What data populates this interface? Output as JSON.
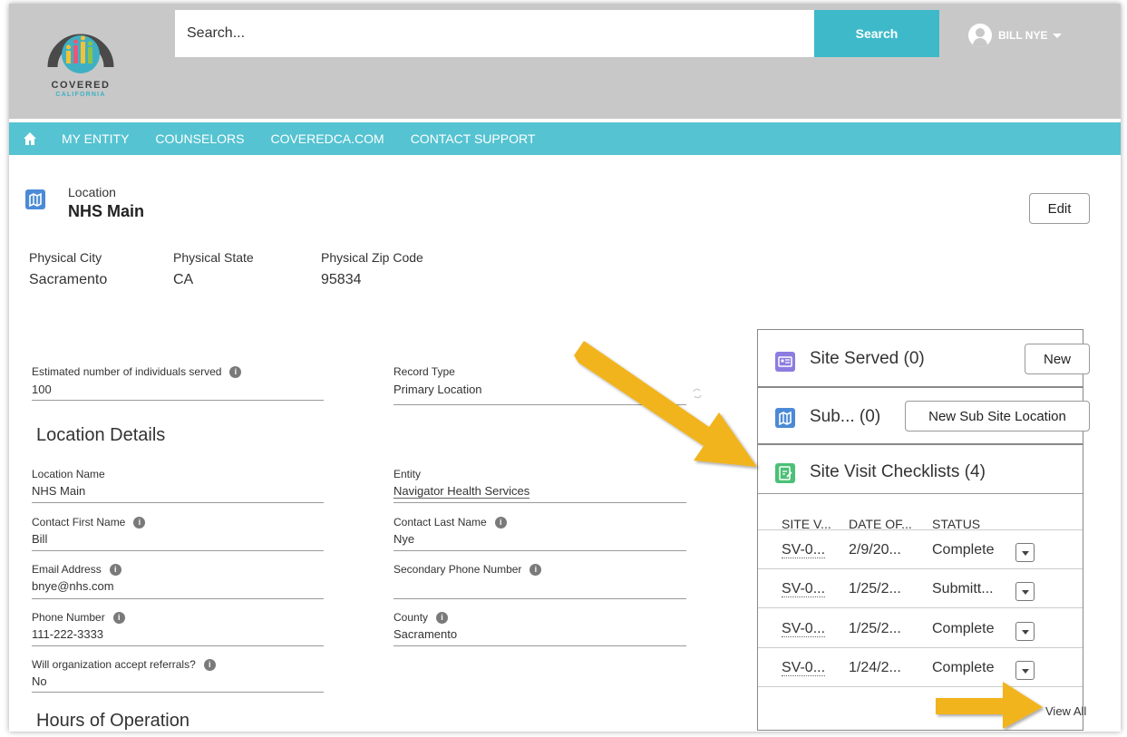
{
  "header": {
    "logo_line1": "COVERED",
    "logo_line2": "CALIFORNIA",
    "search_placeholder": "Search...",
    "search_button": "Search",
    "user_name": "BILL NYE"
  },
  "nav": {
    "items": [
      "MY ENTITY",
      "COUNSELORS",
      "COVEREDCA.COM",
      "CONTACT SUPPORT"
    ]
  },
  "record": {
    "type": "Location",
    "name": "NHS Main",
    "edit_label": "Edit",
    "highlights": [
      {
        "label": "Physical City",
        "value": "Sacramento"
      },
      {
        "label": "Physical State",
        "value": "CA"
      },
      {
        "label": "Physical Zip Code",
        "value": "95834"
      }
    ]
  },
  "fields": {
    "estimated_label": "Estimated number of individuals served",
    "estimated_value": "100",
    "record_type_label": "Record Type",
    "record_type_value": "Primary Location",
    "section_location": "Location Details",
    "location_name_label": "Location Name",
    "location_name_value": "NHS Main",
    "entity_label": "Entity",
    "entity_value": "Navigator Health Services",
    "contact_first_label": "Contact First Name",
    "contact_first_value": "Bill",
    "contact_last_label": "Contact Last Name",
    "contact_last_value": "Nye",
    "email_label": "Email Address",
    "email_value": "bnye@nhs.com",
    "secondary_phone_label": "Secondary Phone Number",
    "secondary_phone_value": "",
    "phone_label": "Phone Number",
    "phone_value": "111-222-3333",
    "county_label": "County",
    "county_value": "Sacramento",
    "referrals_label": "Will organization accept referrals?",
    "referrals_value": "No",
    "section_hours": "Hours of Operation"
  },
  "related": {
    "site_served_title": "Site Served (0)",
    "site_served_button": "New",
    "sub_site_title": "Sub... (0)",
    "sub_site_button": "New Sub Site Location",
    "checklists_title": "Site Visit Checklists (4)",
    "columns": [
      "SITE V...",
      "DATE OF...",
      "STATUS"
    ],
    "rows": [
      {
        "id": "SV-0...",
        "date": "2/9/20...",
        "status": "Complete"
      },
      {
        "id": "SV-0...",
        "date": "1/25/2...",
        "status": "Submitt..."
      },
      {
        "id": "SV-0...",
        "date": "1/25/2...",
        "status": "Complete"
      },
      {
        "id": "SV-0...",
        "date": "1/24/2...",
        "status": "Complete"
      }
    ],
    "view_all": "View All"
  },
  "colors": {
    "nav": "#55c3d1",
    "search_button": "#3eb9c9",
    "header_bg": "#c8c8c8",
    "arrow": "#f1b41f"
  }
}
